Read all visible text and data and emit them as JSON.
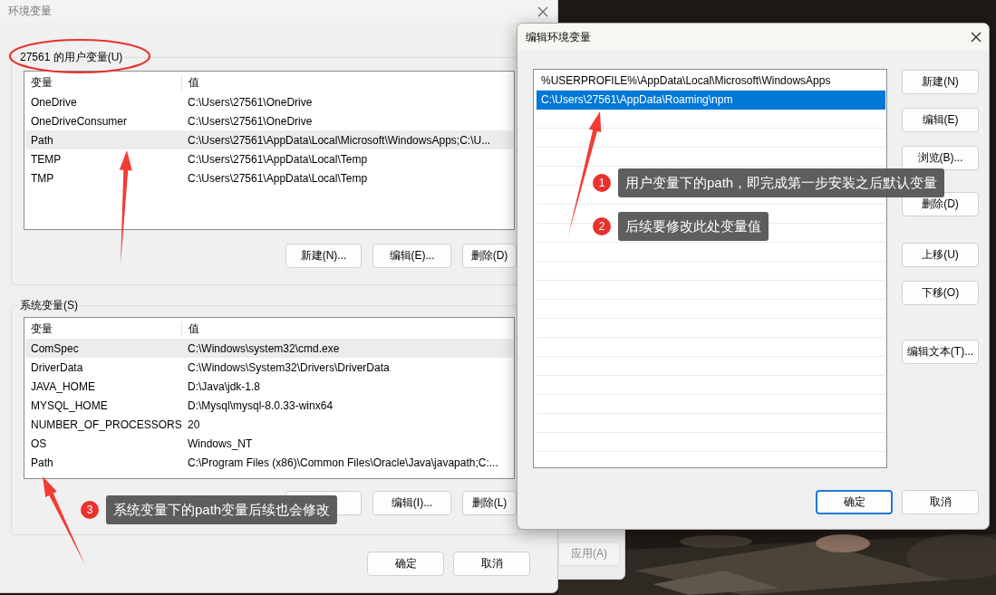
{
  "env_dialog": {
    "title": "环境变量",
    "user_group": {
      "label": "27561 的用户变量(U)",
      "columns": [
        "变量",
        "值"
      ],
      "rows": [
        {
          "name": "OneDrive",
          "value": "C:\\Users\\27561\\OneDrive",
          "selected": false
        },
        {
          "name": "OneDriveConsumer",
          "value": "C:\\Users\\27561\\OneDrive",
          "selected": false
        },
        {
          "name": "Path",
          "value": "C:\\Users\\27561\\AppData\\Local\\Microsoft\\WindowsApps;C:\\U...",
          "selected": true
        },
        {
          "name": "TEMP",
          "value": "C:\\Users\\27561\\AppData\\Local\\Temp",
          "selected": false
        },
        {
          "name": "TMP",
          "value": "C:\\Users\\27561\\AppData\\Local\\Temp",
          "selected": false
        }
      ],
      "buttons": [
        "新建(N)...",
        "编辑(E)...",
        "删除(D)"
      ]
    },
    "system_group": {
      "label": "系统变量(S)",
      "columns": [
        "变量",
        "值"
      ],
      "rows": [
        {
          "name": "ComSpec",
          "value": "C:\\Windows\\system32\\cmd.exe",
          "selected": true
        },
        {
          "name": "DriverData",
          "value": "C:\\Windows\\System32\\Drivers\\DriverData",
          "selected": false
        },
        {
          "name": "JAVA_HOME",
          "value": "D:\\Java\\jdk-1.8",
          "selected": false
        },
        {
          "name": "MYSQL_HOME",
          "value": "D:\\Mysql\\mysql-8.0.33-winx64",
          "selected": false
        },
        {
          "name": "NUMBER_OF_PROCESSORS",
          "value": "20",
          "selected": false
        },
        {
          "name": "OS",
          "value": "Windows_NT",
          "selected": false
        },
        {
          "name": "Path",
          "value": "C:\\Program Files (x86)\\Common Files\\Oracle\\Java\\javapath;C:...",
          "selected": false
        }
      ],
      "buttons": [
        "编辑(I)...",
        "删除(L)"
      ]
    },
    "buttons": [
      "确定",
      "取消"
    ]
  },
  "background_window": {
    "buttons": [
      "应用(A)"
    ]
  },
  "edit_dialog": {
    "title": "编辑环境变量",
    "entries": [
      {
        "text": "%USERPROFILE%\\AppData\\Local\\Microsoft\\WindowsApps",
        "selected": false
      },
      {
        "text": "C:\\Users\\27561\\AppData\\Roaming\\npm",
        "selected": true
      }
    ],
    "side_button_groups": [
      [
        "新建(N)",
        "编辑(E)",
        "浏览(B)...",
        "删除(D)"
      ],
      [
        "上移(U)",
        "下移(O)"
      ],
      [
        "编辑文本(T)..."
      ]
    ],
    "buttons": [
      {
        "label": "确定",
        "default": true
      },
      {
        "label": "取消",
        "default": false
      }
    ]
  },
  "annotations": [
    {
      "number": "1",
      "text": "用户变量下的path，即完成第一步安装之后默认变量"
    },
    {
      "number": "2",
      "text": "后续要修改此处变量值"
    },
    {
      "number": "3",
      "text": "系统变量下的path变量后续也会修改"
    }
  ]
}
